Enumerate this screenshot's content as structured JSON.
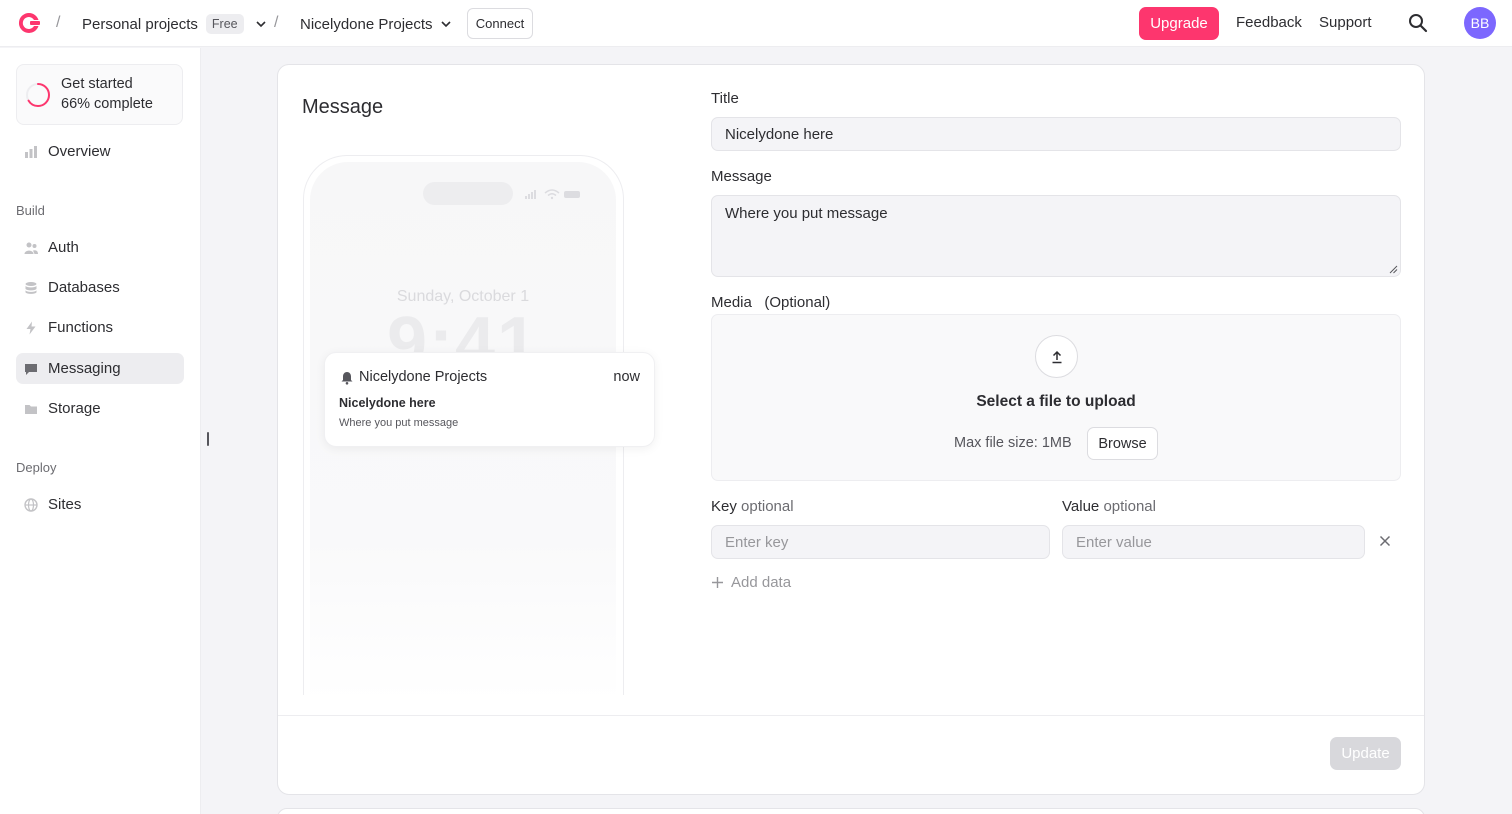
{
  "header": {
    "org_name": "Personal projects",
    "plan_badge": "Free",
    "project_name": "Nicelydone Projects",
    "connect_label": "Connect",
    "separator": "/",
    "upgrade_label": "Upgrade",
    "feedback_label": "Feedback",
    "support_label": "Support",
    "avatar_initials": "BB"
  },
  "sidebar": {
    "get_started_title": "Get started",
    "get_started_progress": "66% complete",
    "progress_fraction": 0.66,
    "overview_label": "Overview",
    "build_section": "Build",
    "build_items": [
      {
        "label": "Auth",
        "icon": "users-icon"
      },
      {
        "label": "Databases",
        "icon": "database-icon"
      },
      {
        "label": "Functions",
        "icon": "lightning-icon"
      },
      {
        "label": "Messaging",
        "icon": "chat-icon",
        "active": true
      },
      {
        "label": "Storage",
        "icon": "folder-icon"
      }
    ],
    "deploy_section": "Deploy",
    "deploy_items": [
      {
        "label": "Sites",
        "icon": "globe-icon"
      }
    ]
  },
  "card": {
    "title": "Message",
    "update_label": "Update"
  },
  "preview": {
    "date": "Sunday, October 1",
    "time": "9:41",
    "notification": {
      "app": "Nicelydone Projects",
      "time": "now",
      "title": "Nicelydone here",
      "body": "Where you put message"
    }
  },
  "form": {
    "title_label": "Title",
    "title_value": "Nicelydone here",
    "message_label": "Message",
    "message_value": "Where you put message",
    "media_label": "Media",
    "media_optional": "(Optional)",
    "upload_title": "Select a file to upload",
    "upload_max": "Max file size: 1MB",
    "browse_label": "Browse",
    "key_label": "Key",
    "value_label": "Value",
    "optional_text": "optional",
    "key_placeholder": "Enter key",
    "value_placeholder": "Enter value",
    "add_data_label": "Add data"
  },
  "colors": {
    "accent": "#fd366e",
    "avatar": "#7c67fe"
  }
}
